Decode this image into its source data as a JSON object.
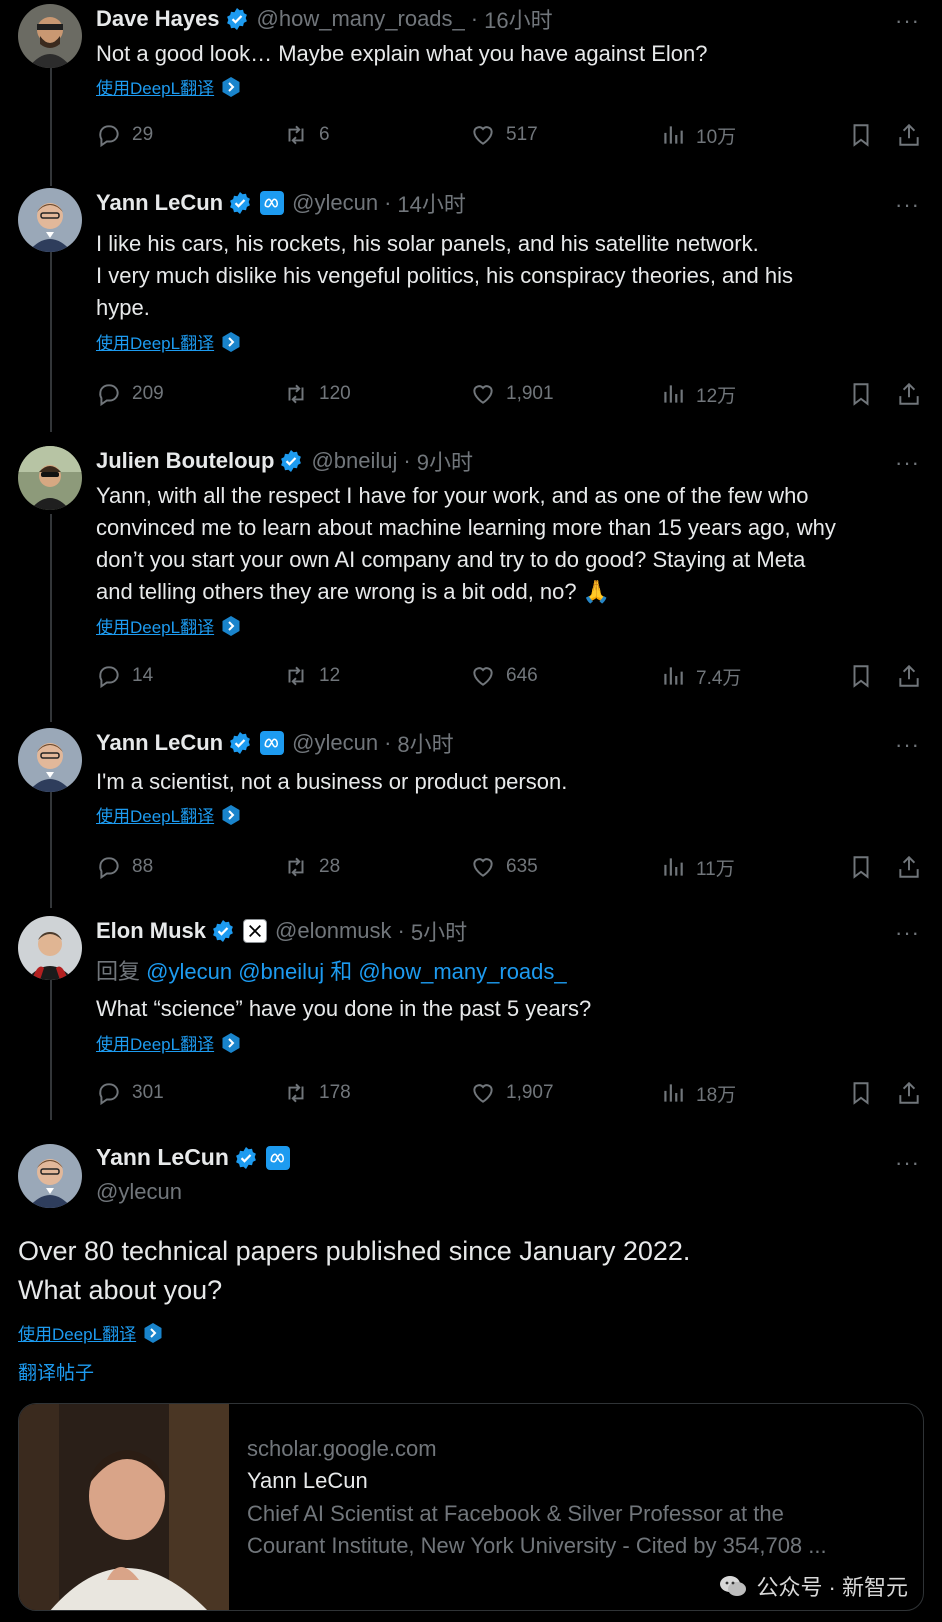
{
  "colors": {
    "accent": "#1d9bf0",
    "muted": "#71767b",
    "text": "#e7e9ea",
    "background": "#000000"
  },
  "tweets": [
    {
      "name": "Dave Hayes",
      "handle": "@how_many_roads_",
      "dot": "·",
      "time": "16小时",
      "text": "Not a good look… Maybe explain what you have against Elon?",
      "translate": "使用DeepL翻译",
      "replies": "29",
      "retweets": "6",
      "likes": "517",
      "views": "10万"
    },
    {
      "name": "Yann LeCun",
      "affiliate": "meta",
      "handle": "@ylecun",
      "dot": "·",
      "time": "14小时",
      "text_lines": [
        "I like his cars, his rockets, his solar panels, and his satellite network.",
        "I very much dislike his vengeful politics, his conspiracy theories, and his",
        "hype."
      ],
      "translate": "使用DeepL翻译",
      "replies": "209",
      "retweets": "120",
      "likes": "1,901",
      "views": "12万"
    },
    {
      "name": "Julien Bouteloup",
      "handle": "@bneiluj",
      "dot": "·",
      "time": "9小时",
      "text_lines": [
        "Yann, with all the respect I have for your work, and as one of the few who",
        "convinced me to learn about machine learning more than 15 years ago, why",
        "don’t you start your own AI company and try to do good? Staying at Meta",
        "and telling others they are wrong is a bit odd, no? 🙏"
      ],
      "translate": "使用DeepL翻译",
      "replies": "14",
      "retweets": "12",
      "likes": "646",
      "views": "7.4万"
    },
    {
      "name": "Yann LeCun",
      "affiliate": "meta",
      "handle": "@ylecun",
      "dot": "·",
      "time": "8小时",
      "text": "I'm a scientist, not a business or product person.",
      "translate": "使用DeepL翻译",
      "replies": "88",
      "retweets": "28",
      "likes": "635",
      "views": "11万"
    },
    {
      "name": "Elon Musk",
      "affiliate": "x",
      "handle": "@elonmusk",
      "dot": "·",
      "time": "5小时",
      "reply_prefix": "回复",
      "reply_mention_1": "@ylecun",
      "reply_mention_2": "@bneiluj",
      "reply_and": "和",
      "reply_mention_3": "@how_many_roads_",
      "text": "What “science” have you done in the past 5 years?",
      "translate": "使用DeepL翻译",
      "replies": "301",
      "retweets": "178",
      "likes": "1,907",
      "views": "18万"
    }
  ],
  "main": {
    "name": "Yann LeCun",
    "handle": "@ylecun",
    "text_line_1": "Over 80 technical papers published since January 2022.",
    "text_line_2": "What about you?",
    "translate": "使用DeepL翻译",
    "translate_post": "翻译帖子",
    "card": {
      "domain": "scholar.google.com",
      "title": "Yann LeCun",
      "desc_line_1": "Chief AI Scientist at Facebook & Silver Professor at the",
      "desc_line_2": "Courant Institute, New York University - Cited by 354,708 ..."
    }
  },
  "more_glyph": "···",
  "watermark": {
    "text": "公众号 · 新智元"
  }
}
